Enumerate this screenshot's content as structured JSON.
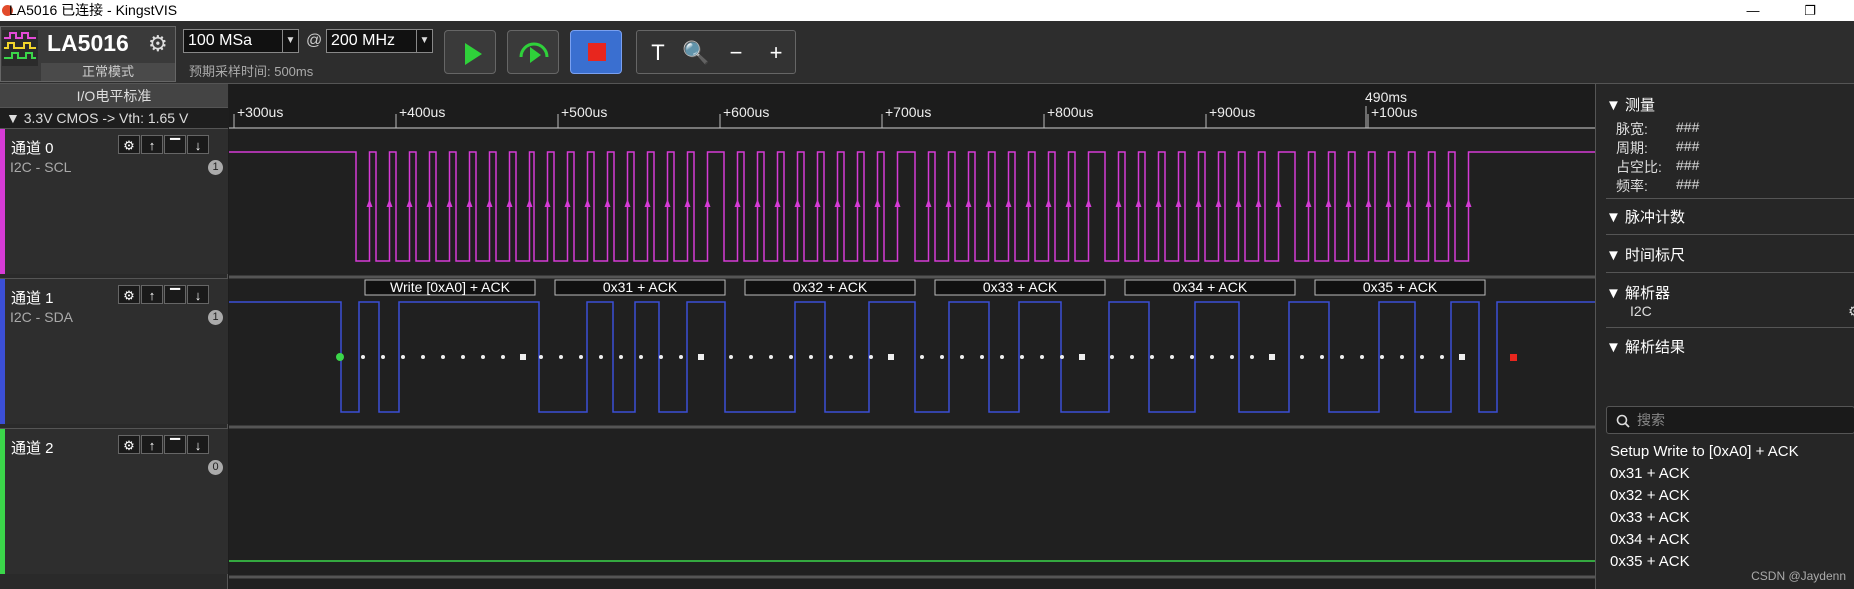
{
  "window": {
    "title": "LA5016 已连接 - KingstVIS",
    "minimize": "—",
    "restore": "❐"
  },
  "device": {
    "model": "LA5016",
    "mode": "正常模式"
  },
  "sampling": {
    "depth": "100 MSa",
    "at": "@",
    "rate": "200 MHz",
    "estimate": "预期采样时间: 500ms"
  },
  "toolbar": {
    "tool_text": "T",
    "tool_zoom_fit": "🔍",
    "tool_zoom_out": "−",
    "tool_zoom_in": "+"
  },
  "io": {
    "header": "I/O电平标准",
    "value": "▼ 3.3V CMOS -> Vth: 1.65 V"
  },
  "ruler": {
    "cursor": "490ms",
    "ticks": [
      "+300us",
      "+400us",
      "+500us",
      "+600us",
      "+700us",
      "+800us",
      "+900us",
      "+100us"
    ]
  },
  "channels": [
    {
      "name": "通道 0",
      "sub": "I2C - SCL",
      "badge": "1",
      "color": "#d63bd6"
    },
    {
      "name": "通道 1",
      "sub": "I2C - SDA",
      "badge": "1",
      "color": "#3b4fd6"
    },
    {
      "name": "通道 2",
      "sub": "",
      "badge": "0",
      "color": "#3bd64a"
    }
  ],
  "channel_tools": [
    "⚙",
    "↑",
    "▔",
    "↓",
    "▁"
  ],
  "decode_frames": [
    "Write [0xA0] + ACK",
    "0x31 + ACK",
    "0x32 + ACK",
    "0x33 + ACK",
    "0x34 + ACK",
    "0x35 + ACK"
  ],
  "measure": {
    "title": "测量",
    "rows": [
      {
        "k": "脉宽:",
        "v": "###"
      },
      {
        "k": "周期:",
        "v": "###"
      },
      {
        "k": "占空比:",
        "v": "###"
      },
      {
        "k": "频率:",
        "v": "###"
      }
    ]
  },
  "sections": {
    "pulse_count": "脉冲计数",
    "time_ruler": "时间标尺",
    "decoder": "解析器",
    "decoder_item": "I2C",
    "results": "解析结果"
  },
  "search": {
    "placeholder": "搜索"
  },
  "results": [
    "Setup Write to [0xA0] + ACK",
    "0x31 + ACK",
    "0x32 + ACK",
    "0x33 + ACK",
    "0x34 + ACK",
    "0x35 + ACK"
  ],
  "watermark": "CSDN @Jaydenn"
}
